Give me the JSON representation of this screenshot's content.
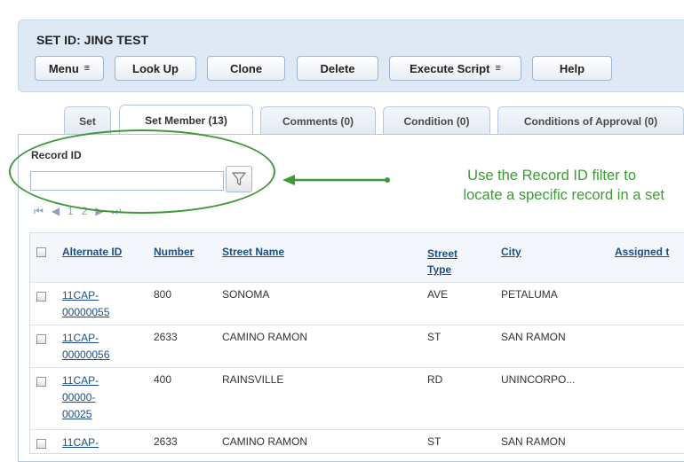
{
  "header": {
    "title": "SET ID: JING TEST",
    "buttons": {
      "menu": "Menu",
      "lookup": "Look Up",
      "clone": "Clone",
      "delete": "Delete",
      "execute_script": "Execute Script",
      "help": "Help"
    }
  },
  "tabs": [
    {
      "label": "Set",
      "active": false
    },
    {
      "label": "Set Member (13)",
      "active": true
    },
    {
      "label": "Comments (0)",
      "active": false
    },
    {
      "label": "Condition (0)",
      "active": false
    },
    {
      "label": "Conditions of Approval (0)",
      "active": false
    }
  ],
  "filter": {
    "label": "Record ID",
    "value": "",
    "icon": "funnel-filter-icon"
  },
  "pager": {
    "first": "first-page-icon",
    "prev": "prev-page-icon",
    "pages": [
      "1",
      "2"
    ],
    "next": "next-page-icon",
    "last": "last-page-icon"
  },
  "annotation": {
    "line1": "Use the Record ID filter to",
    "line2": "locate a specific record in a set",
    "color": "#3e9a38"
  },
  "table": {
    "columns": {
      "alternate_id": "Alternate ID",
      "number": "Number",
      "street_name": "Street Name",
      "street_type_l1": "Street",
      "street_type_l2": "Type",
      "city": "City",
      "assigned_to": "Assigned t"
    },
    "rows": [
      {
        "alt1": "11CAP-",
        "alt2": "00000055",
        "alt3": "",
        "number": "800",
        "street": "SONOMA",
        "type": "AVE",
        "city": "PETALUMA"
      },
      {
        "alt1": "11CAP-",
        "alt2": "00000056",
        "alt3": "",
        "number": "2633",
        "street": "CAMINO RAMON",
        "type": "ST",
        "city": "SAN RAMON"
      },
      {
        "alt1": "11CAP-",
        "alt2": "00000-",
        "alt3": "00025",
        "number": "400",
        "street": "RAINSVILLE",
        "type": "RD",
        "city": "UNINCORPO..."
      },
      {
        "alt1": "11CAP-",
        "alt2": "",
        "alt3": "",
        "number": "2633",
        "street": "CAMINO RAMON",
        "type": "ST",
        "city": "SAN RAMON"
      }
    ]
  },
  "colors": {
    "header_bg": "#dfe9f5",
    "link": "#1b4f8a",
    "annotation_green": "#3e9a38"
  }
}
